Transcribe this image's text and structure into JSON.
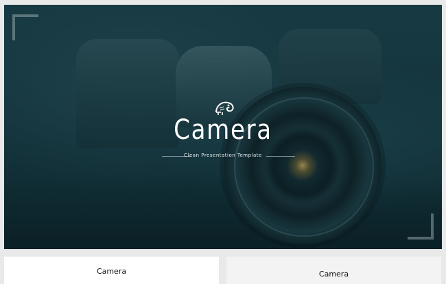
{
  "hero": {
    "title": "Camera",
    "subtitle": "Clean Presentation Template",
    "logo_icon": "chameleon-logo-icon"
  },
  "thumbnails": [
    {
      "title": "Camera"
    },
    {
      "title": "Camera"
    }
  ],
  "colors": {
    "hero_bg": "#16343c",
    "title_text": "#ffffff",
    "page_bg": "#e9e9e9"
  }
}
